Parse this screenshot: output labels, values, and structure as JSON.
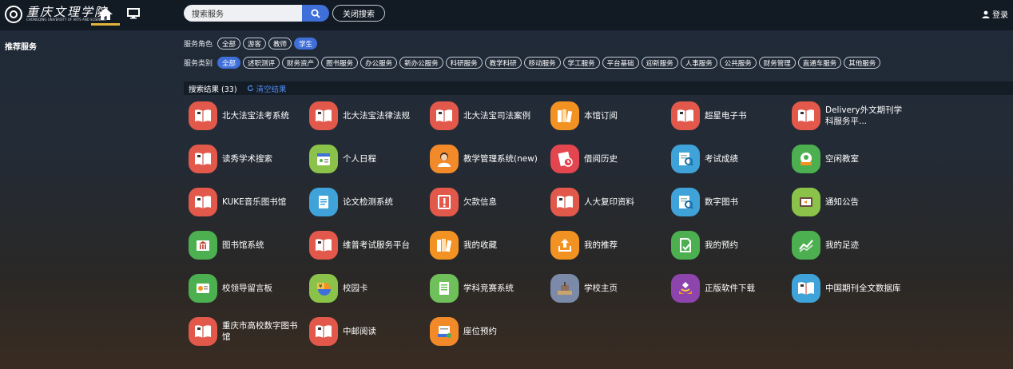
{
  "header": {
    "logo_text": "重庆文理学院",
    "logo_sub": "CHONGQING UNIVERSITY OF ARTS AND SCIENCES",
    "search_placeholder": "搜索服务",
    "close_search": "关闭搜索",
    "login": "登录"
  },
  "sidebar": {
    "title": "推荐服务"
  },
  "filters": {
    "role_label": "服务角色",
    "roles": [
      "全部",
      "游客",
      "教师",
      "学生"
    ],
    "active_role": 3,
    "category_label": "服务类别",
    "categories": [
      "全部",
      "述职测评",
      "财务资产",
      "图书服务",
      "办公服务",
      "新办公服务",
      "科研服务",
      "教学科研",
      "移动服务",
      "学工服务",
      "平台基础",
      "迎新服务",
      "人事服务",
      "公共服务",
      "财务管理",
      "直通车服务",
      "其他服务"
    ],
    "active_category": 0
  },
  "results": {
    "label": "搜索结果 (33)",
    "clear": "清空结果"
  },
  "services": [
    {
      "name": "北大法宝法考系统",
      "icon": "book-icon",
      "color": "#e2584a"
    },
    {
      "name": "北大法宝法律法规",
      "icon": "book-icon",
      "color": "#e2584a"
    },
    {
      "name": "北大法宝司法案例",
      "icon": "book-icon",
      "color": "#e2584a"
    },
    {
      "name": "本馆订阅",
      "icon": "bookshelf-icon",
      "color": "#f29222"
    },
    {
      "name": "超星电子书",
      "icon": "book-icon",
      "color": "#e2584a"
    },
    {
      "name": "Delivery外文期刊学科服务平...",
      "icon": "book-icon",
      "color": "#e2584a"
    },
    {
      "name": "读秀学术搜索",
      "icon": "book-icon",
      "color": "#e2584a"
    },
    {
      "name": "个人日程",
      "icon": "calendar-icon",
      "color": "#8bc34a"
    },
    {
      "name": "教学管理系统(new)",
      "icon": "person-icon",
      "color": "#f28a2a"
    },
    {
      "name": "借阅历史",
      "icon": "history-icon",
      "color": "#e4464f"
    },
    {
      "name": "考试成绩",
      "icon": "score-icon",
      "color": "#3fa2d8"
    },
    {
      "name": "空闲教室",
      "icon": "classroom-icon",
      "color": "#4caf50"
    },
    {
      "name": "KUKE音乐图书馆",
      "icon": "book-icon",
      "color": "#e2584a"
    },
    {
      "name": "论文检测系统",
      "icon": "document-icon",
      "color": "#3fa2d8"
    },
    {
      "name": "欠款信息",
      "icon": "alert-icon",
      "color": "#e2584a"
    },
    {
      "name": "人大复印资料",
      "icon": "book-icon",
      "color": "#e2584a"
    },
    {
      "name": "数字图书",
      "icon": "search-book-icon",
      "color": "#3fa2d8"
    },
    {
      "name": "通知公告",
      "icon": "notice-icon",
      "color": "#8bc34a"
    },
    {
      "name": "图书馆系统",
      "icon": "library-icon",
      "color": "#4caf50"
    },
    {
      "name": "维普考试服务平台",
      "icon": "book-icon",
      "color": "#e2584a"
    },
    {
      "name": "我的收藏",
      "icon": "favorite-books-icon",
      "color": "#f29222"
    },
    {
      "name": "我的推荐",
      "icon": "upload-icon",
      "color": "#f29222"
    },
    {
      "name": "我的预约",
      "icon": "reservation-icon",
      "color": "#4caf50"
    },
    {
      "name": "我的足迹",
      "icon": "trend-icon",
      "color": "#4caf50"
    },
    {
      "name": "校领导留言板",
      "icon": "message-board-icon",
      "color": "#4caf50"
    },
    {
      "name": "校园卡",
      "icon": "campus-card-icon",
      "color": "#8bc34a"
    },
    {
      "name": "学科竞赛系统",
      "icon": "competition-icon",
      "color": "#6fbf5a"
    },
    {
      "name": "学校主页",
      "icon": "campus-building-icon",
      "color": "#7a8aa8"
    },
    {
      "name": "正版软件下载",
      "icon": "software-icon",
      "color": "#8e44ad"
    },
    {
      "name": "中国期刊全文数据库",
      "icon": "book-search-icon",
      "color": "#3fa2d8"
    },
    {
      "name": "重庆市高校数字图书馆",
      "icon": "book-icon",
      "color": "#e2584a"
    },
    {
      "name": "中邮阅读",
      "icon": "book-icon",
      "color": "#e2584a"
    },
    {
      "name": "座位预约",
      "icon": "seat-icon",
      "color": "#f28a2a"
    }
  ]
}
